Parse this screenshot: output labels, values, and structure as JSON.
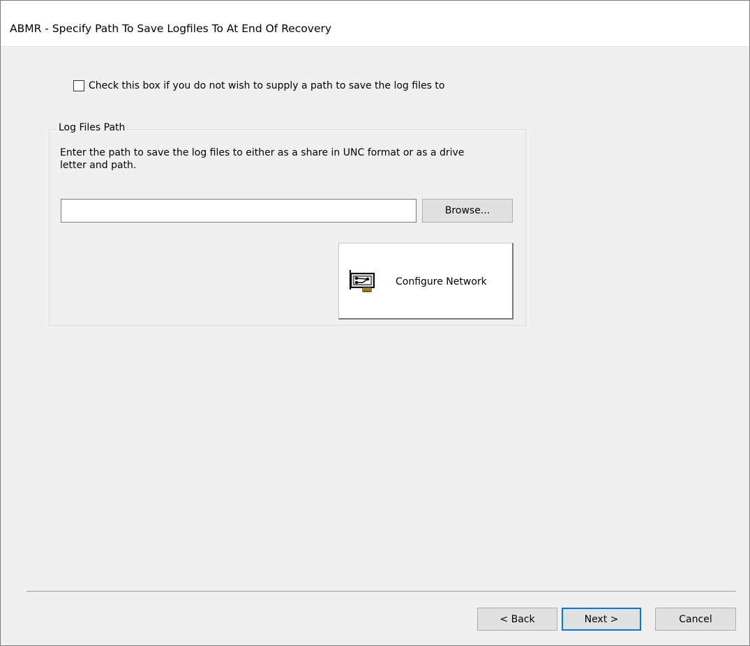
{
  "window": {
    "title": "ABMR - Specify Path To Save Logfiles To At End Of Recovery"
  },
  "skip_option": {
    "label": "Check this box if you do not wish to supply a path to save the log files to",
    "checked": false
  },
  "log_files_group": {
    "legend": "Log Files Path",
    "description": "Enter the path to save the log files to either as a share in UNC format or as a drive letter and path.",
    "path_value": "",
    "browse_label": "Browse...",
    "configure_network_label": "Configure Network",
    "configure_network_icon": "network-card-icon"
  },
  "footer": {
    "back_label": "< Back",
    "next_label": "Next >",
    "cancel_label": "Cancel"
  },
  "colors": {
    "dialog_background": "#f0f0f0",
    "title_background": "#ffffff",
    "default_button_border": "#0078d7"
  }
}
